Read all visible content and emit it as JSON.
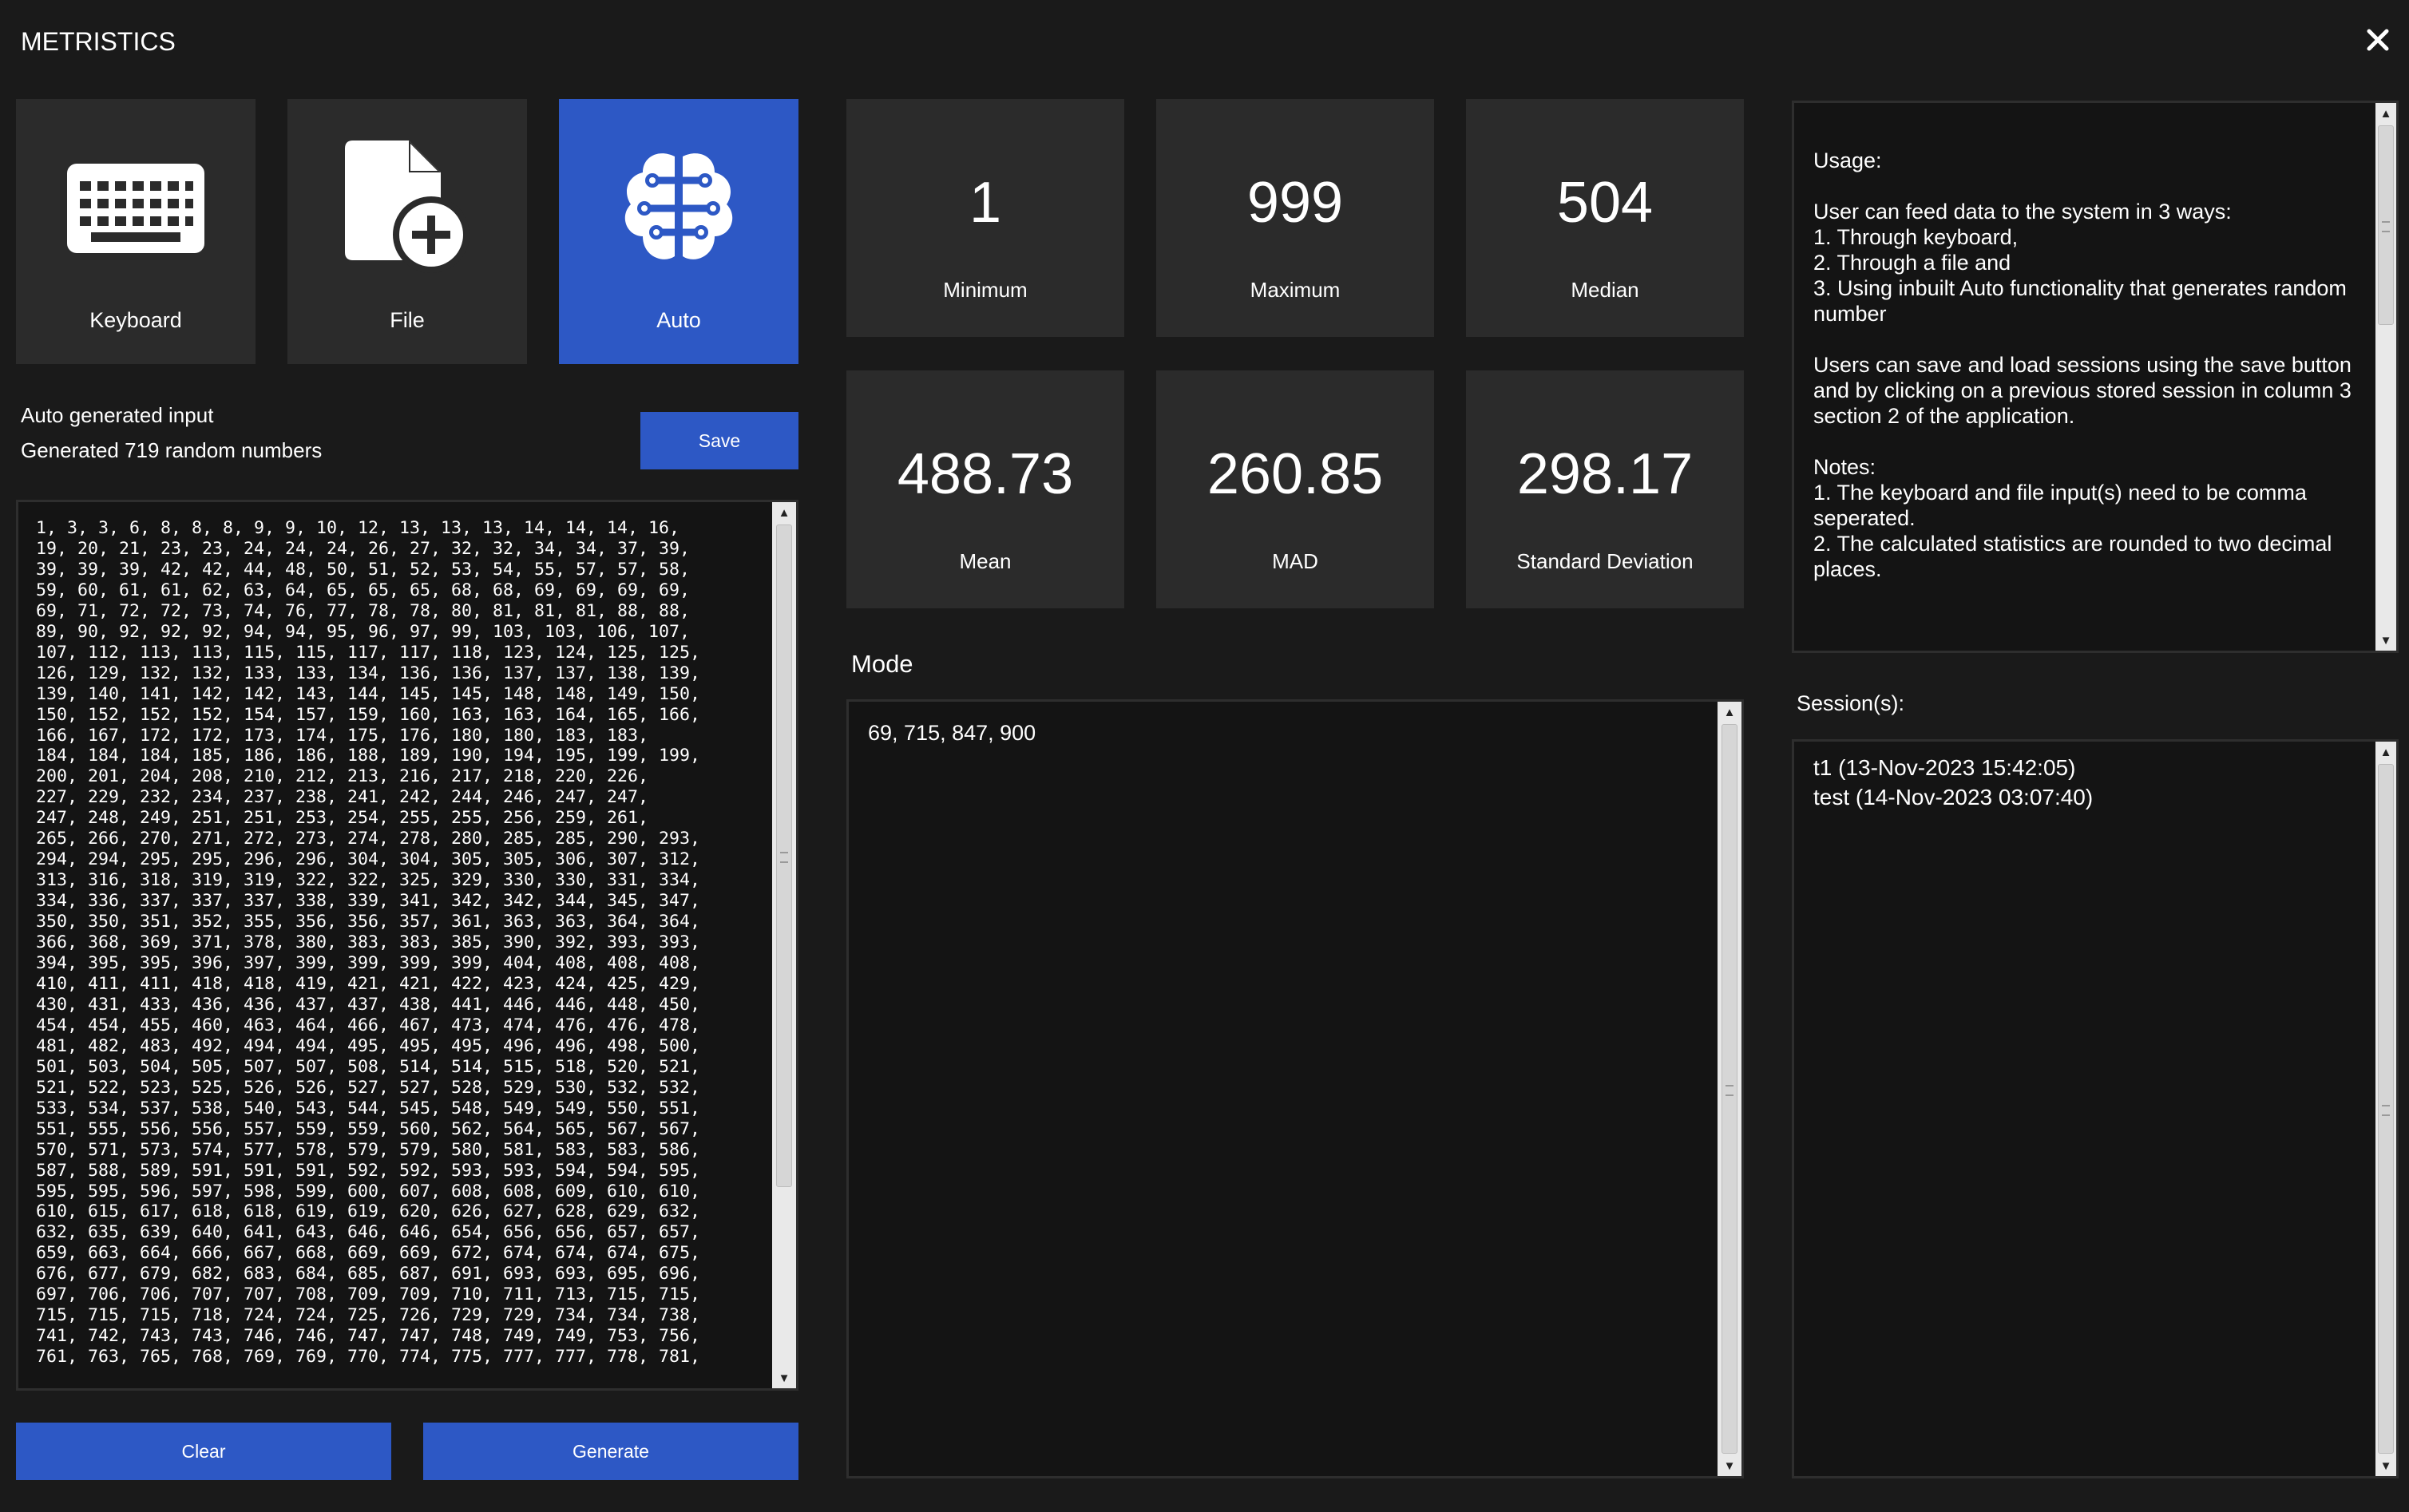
{
  "app": {
    "title": "METRISTICS"
  },
  "modes": [
    {
      "label": "Keyboard",
      "icon": "keyboard-icon",
      "active": false
    },
    {
      "label": "File",
      "icon": "file-plus-icon",
      "active": false
    },
    {
      "label": "Auto",
      "icon": "brain-icon",
      "active": true
    }
  ],
  "input": {
    "heading": "Auto generated input",
    "status": "Generated 719 random numbers",
    "save_label": "Save",
    "numbers": "1, 3, 3, 6, 8, 8, 8, 9, 9, 10, 12, 13, 13, 13, 14, 14, 14, 16, \n19, 20, 21, 23, 23, 24, 24, 24, 26, 27, 32, 32, 34, 34, 37, 39, \n39, 39, 39, 42, 42, 44, 48, 50, 51, 52, 53, 54, 55, 57, 57, 58, \n59, 60, 61, 61, 62, 63, 64, 65, 65, 65, 68, 68, 69, 69, 69, 69, \n69, 71, 72, 72, 73, 74, 76, 77, 78, 78, 80, 81, 81, 81, 88, 88, \n89, 90, 92, 92, 92, 94, 94, 95, 96, 97, 99, 103, 103, 106, 107, \n107, 112, 113, 113, 115, 115, 117, 117, 118, 123, 124, 125, 125, \n126, 129, 132, 132, 133, 133, 134, 136, 136, 137, 137, 138, 139, \n139, 140, 141, 142, 142, 143, 144, 145, 145, 148, 148, 149, 150, \n150, 152, 152, 152, 154, 157, 159, 160, 163, 163, 164, 165, 166, \n166, 167, 172, 172, 173, 174, 175, 176, 180, 180, 183, 183, \n184, 184, 184, 185, 186, 186, 188, 189, 190, 194, 195, 199, 199, \n200, 201, 204, 208, 210, 212, 213, 216, 217, 218, 220, 226, \n227, 229, 232, 234, 237, 238, 241, 242, 244, 246, 247, 247, \n247, 248, 249, 251, 251, 253, 254, 255, 255, 256, 259, 261, \n265, 266, 270, 271, 272, 273, 274, 278, 280, 285, 285, 290, 293, \n294, 294, 295, 295, 296, 296, 304, 304, 305, 305, 306, 307, 312, \n313, 316, 318, 319, 319, 322, 322, 325, 329, 330, 330, 331, 334, \n334, 336, 337, 337, 337, 338, 339, 341, 342, 342, 344, 345, 347, \n350, 350, 351, 352, 355, 356, 356, 357, 361, 363, 363, 364, 364, \n366, 368, 369, 371, 378, 380, 383, 383, 385, 390, 392, 393, 393, \n394, 395, 395, 396, 397, 399, 399, 399, 399, 404, 408, 408, 408, \n410, 411, 411, 418, 418, 419, 421, 421, 422, 423, 424, 425, 429, \n430, 431, 433, 436, 436, 437, 437, 438, 441, 446, 446, 448, 450, \n454, 454, 455, 460, 463, 464, 466, 467, 473, 474, 476, 476, 478, \n481, 482, 483, 492, 494, 494, 495, 495, 495, 496, 496, 498, 500, \n501, 503, 504, 505, 507, 507, 508, 514, 514, 515, 518, 520, 521, \n521, 522, 523, 525, 526, 526, 527, 527, 528, 529, 530, 532, 532, \n533, 534, 537, 538, 540, 543, 544, 545, 548, 549, 549, 550, 551, \n551, 555, 556, 556, 557, 559, 559, 560, 562, 564, 565, 567, 567, \n570, 571, 573, 574, 577, 578, 579, 579, 580, 581, 583, 583, 586, \n587, 588, 589, 591, 591, 591, 592, 592, 593, 593, 594, 594, 595, \n595, 595, 596, 597, 598, 599, 600, 607, 608, 608, 609, 610, 610, \n610, 615, 617, 618, 618, 619, 619, 620, 626, 627, 628, 629, 632, \n632, 635, 639, 640, 641, 643, 646, 646, 654, 656, 656, 657, 657, \n659, 663, 664, 666, 667, 668, 669, 669, 672, 674, 674, 674, 675, \n676, 677, 679, 682, 683, 684, 685, 687, 691, 693, 693, 695, 696, \n697, 706, 706, 707, 707, 708, 709, 709, 710, 711, 713, 715, 715, \n715, 715, 715, 718, 724, 724, 725, 726, 729, 729, 734, 734, 738, \n741, 742, 743, 743, 746, 746, 747, 747, 748, 749, 749, 753, 756, \n761, 763, 765, 768, 769, 769, 770, 774, 775, 777, 777, 778, 781,",
    "clear_label": "Clear",
    "generate_label": "Generate"
  },
  "stats": {
    "minimum": {
      "value": "1",
      "label": "Minimum"
    },
    "maximum": {
      "value": "999",
      "label": "Maximum"
    },
    "median": {
      "value": "504",
      "label": "Median"
    },
    "mean": {
      "value": "488.73",
      "label": "Mean"
    },
    "mad": {
      "value": "260.85",
      "label": "MAD"
    },
    "std": {
      "value": "298.17",
      "label": "Standard Deviation"
    }
  },
  "mode_section": {
    "title": "Mode",
    "value": "69, 715, 847, 900"
  },
  "usage": {
    "text": "Usage:\n\nUser can feed data to the system in 3 ways:\n1. Through keyboard,\n2. Through a file and\n3. Using inbuilt Auto functionality that generates random number\n\nUsers can save and load sessions using the save button and by clicking on a previous stored session in column 3 section 2 of the application.\n\nNotes:\n1. The keyboard and file input(s) need to be comma seperated.\n2. The calculated statistics are rounded to two decimal places."
  },
  "sessions": {
    "title": "Session(s):",
    "items": [
      "t1 (13-Nov-2023 15:42:05)",
      "test (14-Nov-2023 03:07:40)"
    ]
  },
  "colors": {
    "accent": "#2d58c5",
    "tile": "#2b2b2b",
    "background": "#1a1a1a"
  }
}
